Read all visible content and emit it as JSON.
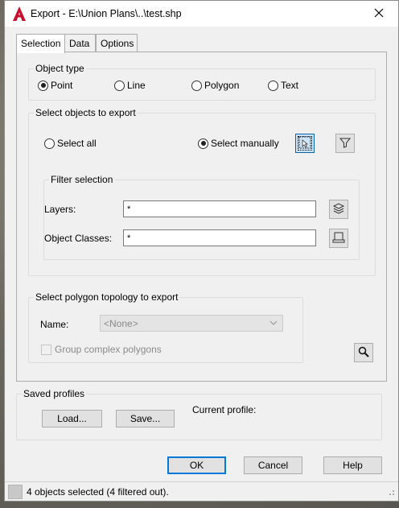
{
  "window": {
    "title": "Export - E:\\Union Plans\\..\\test.shp",
    "app_icon": "autocad-icon",
    "close_icon": "close-icon"
  },
  "tabs": [
    {
      "label": "Selection",
      "active": true
    },
    {
      "label": "Data",
      "active": false
    },
    {
      "label": "Options",
      "active": false
    }
  ],
  "object_type": {
    "title": "Object type",
    "options": [
      {
        "label": "Point",
        "checked": true
      },
      {
        "label": "Line",
        "checked": false
      },
      {
        "label": "Polygon",
        "checked": false
      },
      {
        "label": "Text",
        "checked": false
      }
    ]
  },
  "select_objects": {
    "title": "Select objects to export",
    "select_all_label": "Select all",
    "select_manually_label": "Select manually",
    "selected_option": "Select manually",
    "pick_icon": "select-objects-icon",
    "filter_icon": "filter-icon",
    "filter_selection": {
      "title": "Filter selection",
      "layers_label": "Layers:",
      "layers_value": "*",
      "layers_icon": "layers-icon",
      "object_classes_label": "Object Classes:",
      "object_classes_value": "*",
      "object_classes_icon": "object-classes-icon"
    }
  },
  "polygon_topology": {
    "title": "Select polygon topology to export",
    "name_label": "Name:",
    "name_value": "<None>",
    "group_complex_label": "Group complex polygons",
    "zoom_icon": "magnifier-icon"
  },
  "saved_profiles": {
    "title": "Saved profiles",
    "load_label": "Load...",
    "save_label": "Save...",
    "current_profile_label": "Current profile:"
  },
  "footer": {
    "ok_label": "OK",
    "cancel_label": "Cancel",
    "help_label": "Help"
  },
  "status": {
    "text": "4 objects selected (4 filtered out)."
  },
  "colors": {
    "accent": "#0078d7",
    "app_icon_red": "#c8102e"
  }
}
